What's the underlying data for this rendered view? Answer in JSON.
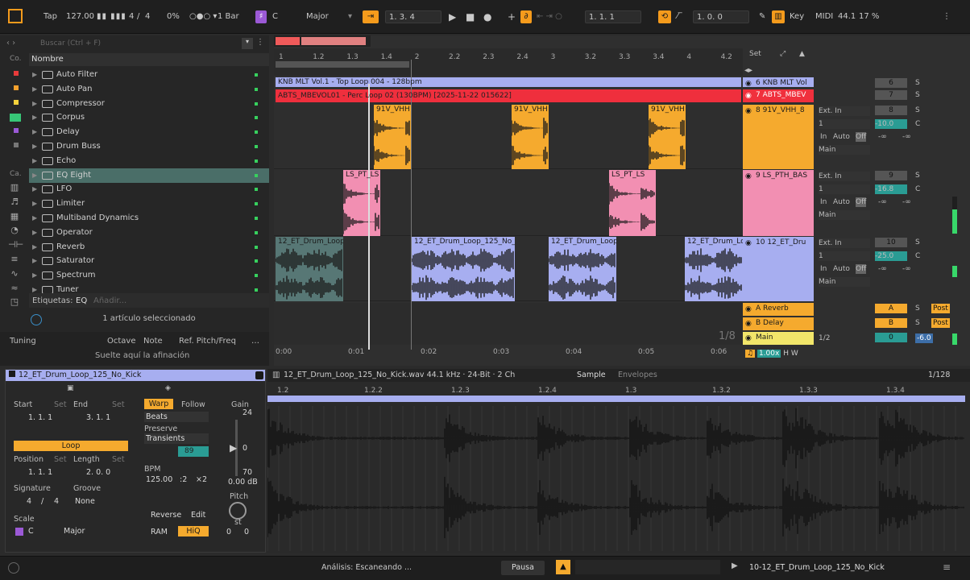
{
  "topbar": {
    "tap": "Tap",
    "tempo": "127.00",
    "sig_num": "4",
    "sig_den": "4",
    "percent": "0%",
    "quant": "1 Bar",
    "scale_key": "C",
    "scale_mode": "Major",
    "pos": "1.   3.   4",
    "loop_start": "1.   1.   1",
    "loop_len": "1.   0.   0",
    "key_label": "Key",
    "midi_label": "MIDI",
    "sample_rate": "44.1",
    "cpu": "17 %"
  },
  "browser": {
    "search_placeholder": "Buscar (Ctrl + F)",
    "col_header": "Nombre",
    "cat1": "Co.",
    "cat2": "Ca.",
    "items": [
      "Auto Filter",
      "Auto Pan",
      "Compressor",
      "Corpus",
      "Delay",
      "Drum Buss",
      "Echo",
      "EQ Eight",
      "LFO",
      "Limiter",
      "Multiband Dynamics",
      "Operator",
      "Reverb",
      "Saturator",
      "Spectrum",
      "Tuner"
    ],
    "tags_label": "Etiquetas:",
    "tag": "EQ",
    "add_tag": "Añadir...",
    "selected": "1 artículo seleccionado",
    "tuning": "Tuning",
    "octave": "Octave",
    "note": "Note",
    "ref": "Ref. Pitch/Freq",
    "drop_hint": "Suelte aquí la afinación"
  },
  "arrangement": {
    "ruler": [
      "1",
      "1.2",
      "1.3",
      "1.4",
      "2",
      "2.2",
      "2.3",
      "2.4",
      "3",
      "3.2",
      "3.3",
      "3.4",
      "4",
      "4.2"
    ],
    "set_label": "Set",
    "clip_top": "KNB MLT Vol.1 - Top Loop 004 - 128bpm",
    "clip_perc": "ABTS_MBEVOL01 - Perc Loop 02 (130BPM) [2025-11-22 015622]",
    "clip_vhh": "91V_VHH",
    "clip_ls": "LS_PT_LS",
    "clip_ls2": "LS_PT_LS",
    "clip_drum": "12_ET_Drum_Loop",
    "clip_drum_long": "12_ET_Drum_Loop_125_No_Kick",
    "time": [
      "0:00",
      "0:01",
      "0:02",
      "0:03",
      "0:04",
      "0:05",
      "0:06"
    ],
    "grid": "1/8",
    "tracks": [
      {
        "name": "6 KNB MLT Vol",
        "num": "6",
        "color": "#a7aef0"
      },
      {
        "name": "7 ABTS_MBEV",
        "num": "7",
        "color": "#f0303d"
      },
      {
        "name": "8 91V_VHH_8",
        "num": "8",
        "color": "#f5aa2e"
      },
      {
        "name": "9 LS_PTH_BAS",
        "num": "9",
        "color": "#f28fb2"
      },
      {
        "name": "10 12_ET_Dru",
        "num": "10",
        "color": "#a7aef0"
      },
      {
        "name": "A Reverb",
        "num": "A",
        "color": "#f5aa2e"
      },
      {
        "name": "B Delay",
        "num": "B",
        "color": "#f5aa2e"
      },
      {
        "name": "Main",
        "num": "0",
        "color": "#f2e66a"
      }
    ],
    "io": {
      "ext_in": "Ext. In",
      "ch": "1",
      "in": "In",
      "auto": "Auto",
      "off": "Off",
      "main": "Main"
    },
    "vol": [
      "-10.0",
      "-16.8",
      "-25.0"
    ],
    "pan": "C",
    "inf": "-∞",
    "send_s": "S",
    "post": "Post",
    "main_ratio": "1/2",
    "main_vol": "-6.0",
    "zoom": "1.00x",
    "h": "H",
    "w": "W"
  },
  "clipview": {
    "title": "12_ET_Drum_Loop_125_No_Kick",
    "start": "Start",
    "end": "End",
    "set": "Set",
    "start_val": "1.   1.   1",
    "end_val": "3.   1.   1",
    "loop": "Loop",
    "position": "Position",
    "length": "Length",
    "pos_val": "1.   1.   1",
    "len_val": "2.   0.   0",
    "signature": "Signature",
    "groove": "Groove",
    "sig_num": "4",
    "sig_den": "4",
    "groove_val": "None",
    "scale": "Scale",
    "scale_key": "C",
    "scale_mode": "Major",
    "warp": "Warp",
    "follow": "Follow",
    "beats": "Beats",
    "preserve": "Preserve",
    "transients": "Transients",
    "bpm_label": "BPM",
    "bpm": "125.00",
    "half": ":2",
    "double": "×2",
    "reverse": "Reverse",
    "edit": "Edit",
    "ram": "RAM",
    "hiq": "HiQ",
    "gain": "Gain",
    "g24": "24",
    "g0": "0",
    "g70": "70",
    "gdb": "0.00 dB",
    "pitch": "Pitch",
    "st": "st",
    "p0": "0",
    "p1": "0",
    "transient_val": "89"
  },
  "sampleview": {
    "file": "12_ET_Drum_Loop_125_No_Kick.wav  44.1 kHz · 24-Bit · 2 Ch",
    "tab_sample": "Sample",
    "tab_env": "Envelopes",
    "grid": "1/128",
    "ruler": [
      "1.2",
      "1.2.2",
      "1.2.3",
      "1.2.4",
      "1.3",
      "1.3.2",
      "1.3.3",
      "1.3.4"
    ]
  },
  "status": {
    "analysis": "Análisis: Escaneando ...",
    "pause": "Pausa",
    "clip_name": "10-12_ET_Drum_Loop_125_No_Kick"
  }
}
